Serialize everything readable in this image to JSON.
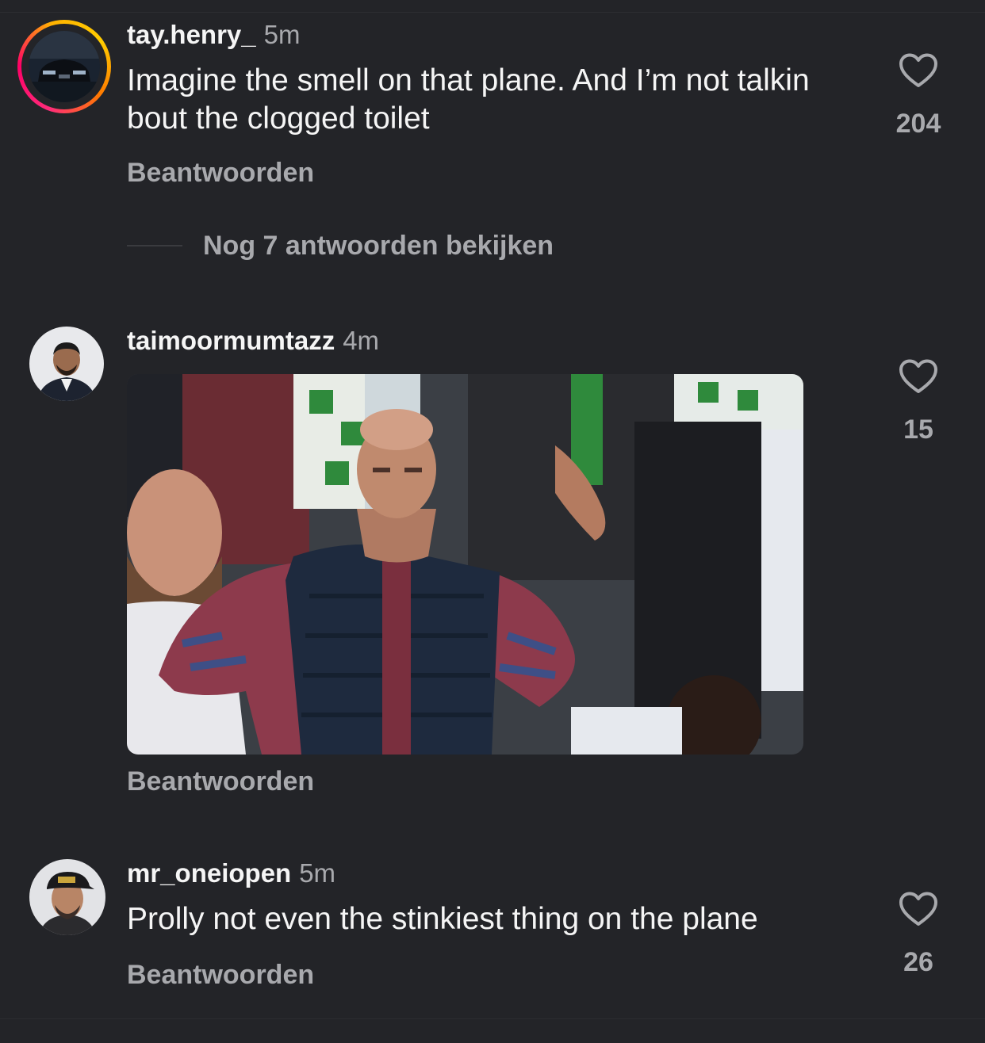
{
  "comments": [
    {
      "username": "tay.henry_",
      "time": "5m",
      "text": "Imagine the smell on that plane. And I’m not talkin bout the clogged toilet",
      "reply_label": "Beantwoorden",
      "likes": "204",
      "has_story_ring": true
    },
    {
      "username": "taimoormumtazz",
      "time": "4m",
      "media": "gif",
      "reply_label": "Beantwoorden",
      "likes": "15"
    },
    {
      "username": "mr_oneiopen",
      "time": "5m",
      "text": "Prolly not even the stinkiest thing on the plane",
      "reply_label": "Beantwoorden",
      "likes": "26"
    }
  ],
  "view_replies_label": "Nog 7 antwoorden bekijken",
  "icons": {
    "like": "heart-outline-icon"
  },
  "colors": {
    "background": "#232428",
    "primary_text": "#f5f5f5",
    "secondary_text": "#a8a9ad"
  }
}
